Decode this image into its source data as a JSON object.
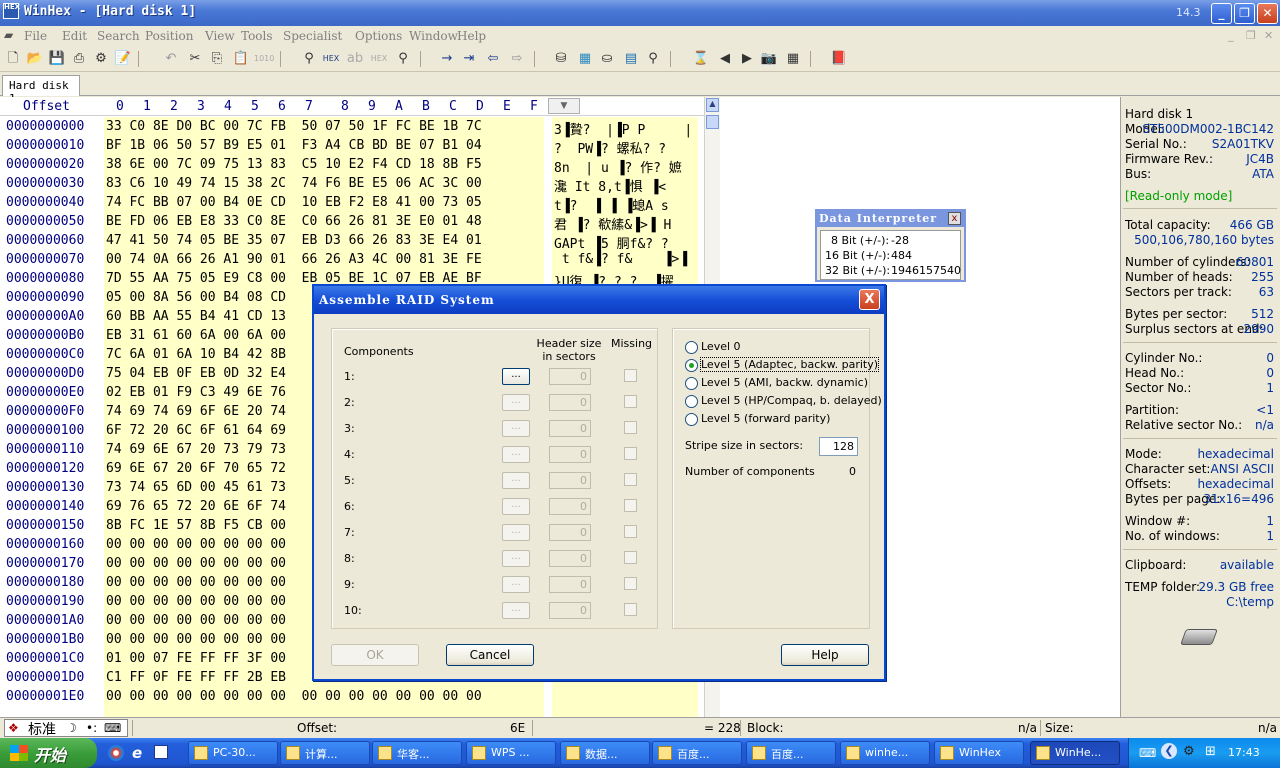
{
  "window": {
    "title": "WinHex - [Hard disk 1]",
    "version": "14.3",
    "app_icon_label": "HEX"
  },
  "menu": [
    "File",
    "Edit",
    "Search",
    "Position",
    "View",
    "Tools",
    "Specialist",
    "Options",
    "Window",
    "Help"
  ],
  "tab": {
    "label": "Hard disk 1"
  },
  "hex_header": {
    "offset_label": "Offset",
    "columns": [
      "0",
      "1",
      "2",
      "3",
      "4",
      "5",
      "6",
      "7",
      "8",
      "9",
      "A",
      "B",
      "C",
      "D",
      "E",
      "F"
    ]
  },
  "hex_rows": [
    {
      "offset": "0000000000",
      "hex": "33 C0 8E D0 BC 00 7C FB  50 07 50 1F FC BE 1B 7C",
      "text": "3▐贄?  |▐P P     |"
    },
    {
      "offset": "0000000010",
      "hex": "BF 1B 06 50 57 B9 E5 01  F3 A4 CB BD BE 07 B1 04",
      "text": "?  PW▐? 螺私? ?"
    },
    {
      "offset": "0000000020",
      "hex": "38 6E 00 7C 09 75 13 83  C5 10 E2 F4 CD 18 8B F5",
      "text": "8n  | u ▐? 作? 嫬"
    },
    {
      "offset": "0000000030",
      "hex": "83 C6 10 49 74 15 38 2C  74 F6 BE E5 06 AC 3C 00",
      "text": "瀺 It 8,t▐惧 ▐<"
    },
    {
      "offset": "0000000040",
      "hex": "74 FC BB 07 00 B4 0E CD  10 EB F2 E8 41 00 73 05",
      "text": "t▐?  ▐ ▐ ▐螅A s"
    },
    {
      "offset": "0000000050",
      "hex": "BE FD 06 EB E8 33 C0 8E  C0 66 26 81 3E E0 01 48",
      "text": "君 ▐? 欷縤&▐>▐ H"
    },
    {
      "offset": "0000000060",
      "hex": "47 41 50 74 05 BE 35 07  EB D3 66 26 83 3E E4 01",
      "text": "GAPt ▐5 胴f&? ?"
    },
    {
      "offset": "0000000070",
      "hex": "00 74 0A 66 26 A1 90 01  66 26 A3 4C 00 81 3E FE",
      "text": " t f&▐? f&    ▐>▐"
    },
    {
      "offset": "0000000080",
      "hex": "7D 55 AA 75 05 E9 C8 00  EB 05 BE 1C 07 EB AE BF",
      "text": "}U復 ▐? ? ?  ▐擢"
    },
    {
      "offset": "0000000090",
      "hex": "05 00 8A 56 00 B4 08 CD",
      "text": ""
    },
    {
      "offset": "00000000A0",
      "hex": "60 BB AA 55 B4 41 CD 13",
      "text": ""
    },
    {
      "offset": "00000000B0",
      "hex": "EB 31 61 60 6A 00 6A 00",
      "text": ""
    },
    {
      "offset": "00000000C0",
      "hex": "7C 6A 01 6A 10 B4 42 8B",
      "text": ""
    },
    {
      "offset": "00000000D0",
      "hex": "75 04 EB 0F EB 0D 32 E4",
      "text": ""
    },
    {
      "offset": "00000000E0",
      "hex": "02 EB 01 F9 C3 49 6E 76",
      "text": ""
    },
    {
      "offset": "00000000F0",
      "hex": "74 69 74 69 6F 6E 20 74",
      "text": ""
    },
    {
      "offset": "0000000100",
      "hex": "6F 72 20 6C 6F 61 64 69",
      "text": ""
    },
    {
      "offset": "0000000110",
      "hex": "74 69 6E 67 20 73 79 73",
      "text": ""
    },
    {
      "offset": "0000000120",
      "hex": "69 6E 67 20 6F 70 65 72",
      "text": ""
    },
    {
      "offset": "0000000130",
      "hex": "73 74 65 6D 00 45 61 73",
      "text": ""
    },
    {
      "offset": "0000000140",
      "hex": "69 76 65 72 20 6E 6F 74",
      "text": ""
    },
    {
      "offset": "0000000150",
      "hex": "8B FC 1E 57 8B F5 CB 00",
      "text": ""
    },
    {
      "offset": "0000000160",
      "hex": "00 00 00 00 00 00 00 00",
      "text": ""
    },
    {
      "offset": "0000000170",
      "hex": "00 00 00 00 00 00 00 00",
      "text": ""
    },
    {
      "offset": "0000000180",
      "hex": "00 00 00 00 00 00 00 00",
      "text": ""
    },
    {
      "offset": "0000000190",
      "hex": "00 00 00 00 00 00 00 00",
      "text": ""
    },
    {
      "offset": "00000001A0",
      "hex": "00 00 00 00 00 00 00 00",
      "text": ""
    },
    {
      "offset": "00000001B0",
      "hex": "00 00 00 00 00 00 00 00",
      "text": ""
    },
    {
      "offset": "00000001C0",
      "hex": "01 00 07 FE FF FF 3F 00",
      "text": ""
    },
    {
      "offset": "00000001D0",
      "hex": "C1 FF 0F FE FF FF 2B EB",
      "text": ""
    },
    {
      "offset": "00000001E0",
      "hex": "00 00 00 00 00 00 00 00  00 00 00 00 00 00 00 00",
      "text": ""
    }
  ],
  "info_panel": {
    "device": "Hard disk 1",
    "rows1": [
      {
        "label": "Model:",
        "value": "ST500DM002-1BC142"
      },
      {
        "label": "Serial No.:",
        "value": "S2A01TKV"
      },
      {
        "label": "Firmware Rev.:",
        "value": "JC4B"
      },
      {
        "label": "Bus:",
        "value": "ATA"
      }
    ],
    "readonly": "[Read-only mode]",
    "total_capacity_label": "Total capacity:",
    "total_capacity_gb": "466 GB",
    "total_capacity_bytes": "500,106,780,160 bytes",
    "rows2": [
      {
        "label": "Number of cylinders:",
        "value": "60801"
      },
      {
        "label": "Number of heads:",
        "value": "255"
      },
      {
        "label": "Sectors per track:",
        "value": "63"
      }
    ],
    "rows3": [
      {
        "label": "Bytes per sector:",
        "value": "512"
      },
      {
        "label": "Surplus sectors at end:",
        "value": "2990"
      }
    ],
    "rows4": [
      {
        "label": "Cylinder No.:",
        "value": "0"
      },
      {
        "label": "Head No.:",
        "value": "0"
      },
      {
        "label": "Sector No.:",
        "value": "1"
      }
    ],
    "rows5": [
      {
        "label": "Partition:",
        "value": "<1"
      },
      {
        "label": "Relative sector No.:",
        "value": "n/a"
      }
    ],
    "rows6": [
      {
        "label": "Mode:",
        "value": "hexadecimal"
      },
      {
        "label": "Character set:",
        "value": "ANSI ASCII"
      },
      {
        "label": "Offsets:",
        "value": "hexadecimal"
      },
      {
        "label": "Bytes per page:",
        "value": "31x16=496"
      }
    ],
    "rows7": [
      {
        "label": "Window #:",
        "value": "1"
      },
      {
        "label": "No. of windows:",
        "value": "1"
      }
    ],
    "clipboard_label": "Clipboard:",
    "clipboard_value": "available",
    "temp_label": "TEMP folder:",
    "temp_free": "29.3 GB free",
    "temp_path": "C:\\temp"
  },
  "interpreter": {
    "title": "Data Interpreter",
    "close": "x",
    "rows": [
      {
        "label": "8 Bit (+/-):",
        "value": "-28"
      },
      {
        "label": "16 Bit (+/-):",
        "value": "484"
      },
      {
        "label": "32 Bit (+/-):",
        "value": "1946157540"
      }
    ]
  },
  "dialog": {
    "title": "Assemble RAID System",
    "close": "X",
    "components_label": "Components",
    "header_size_label": "Header size in sectors",
    "missing_label": "Missing",
    "dots": "...",
    "components": [
      "1:",
      "2:",
      "3:",
      "4:",
      "5:",
      "6:",
      "7:",
      "8:",
      "9:",
      "10:"
    ],
    "header_value": "0",
    "levels": [
      {
        "label": "Level 0",
        "selected": false
      },
      {
        "label": "Level 5 (Adaptec, backw. parity)",
        "selected": true
      },
      {
        "label": "Level 5 (AMI, backw. dynamic)",
        "selected": false
      },
      {
        "label": "Level 5 (HP/Compaq, b. delayed)",
        "selected": false
      },
      {
        "label": "Level 5 (forward parity)",
        "selected": false
      }
    ],
    "stripe_label": "Stripe size in sectors:",
    "stripe_value": "128",
    "num_components_label": "Number of components",
    "num_components_value": "0",
    "ok": "OK",
    "cancel": "Cancel",
    "help": "Help"
  },
  "status": {
    "ime": "标准",
    "offset_label": "Offset:",
    "offset_value": "6E",
    "eq_value": "= 228",
    "block_label": "Block:",
    "block_value": "n/a",
    "size_label": "Size:",
    "size_value": "n/a"
  },
  "taskbar": {
    "start": "开始",
    "items": [
      "PC-30...",
      "计算...",
      "华客...",
      "WPS ...",
      "数据...",
      "百度...",
      "百度...",
      "winhe...",
      "WinHex",
      "WinHe..."
    ],
    "clock": "17:43"
  }
}
